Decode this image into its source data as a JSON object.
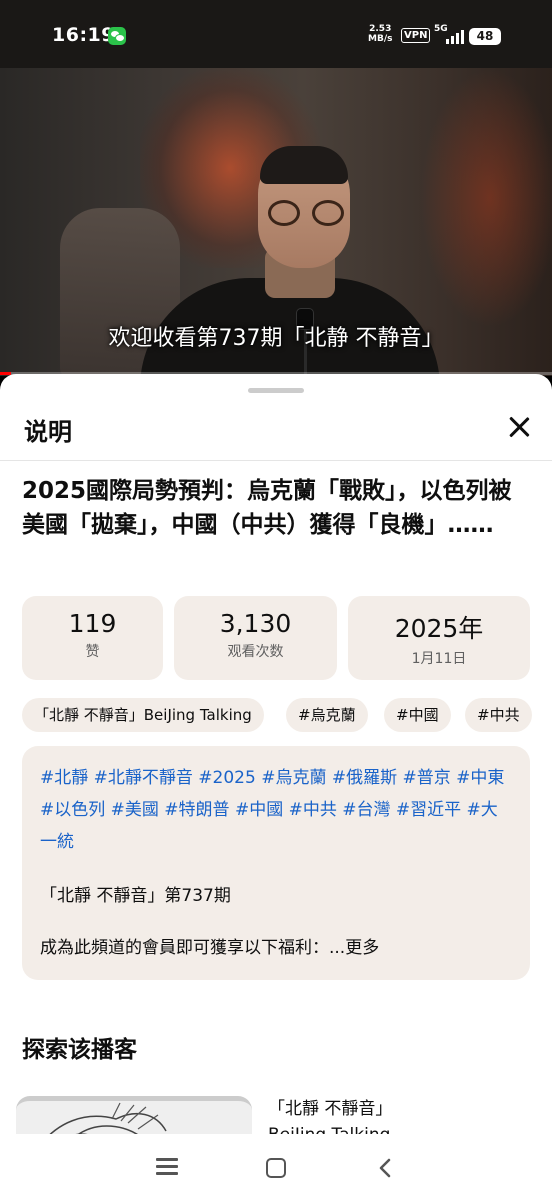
{
  "status_bar": {
    "time": "16:19",
    "speed_value": "2.53",
    "speed_unit": "MB/s",
    "vpn": "VPN",
    "network": "5G",
    "battery": "48"
  },
  "video": {
    "subtitle": "欢迎收看第737期「北静 不静音」",
    "progress": 0.02
  },
  "sheet": {
    "title": "说明",
    "video_title": "2025國際局勢預判：烏克蘭「戰敗」，以色列被美國「拋棄」，中國（中共）獲得「良機」……",
    "stats": [
      {
        "value": "119",
        "label": "赞"
      },
      {
        "value": "3,130",
        "label": "观看次数"
      },
      {
        "value": "2025年",
        "label": "1月11日"
      }
    ],
    "chips": [
      "「北靜 不靜音」BeiJing Talking",
      "#烏克蘭",
      "#中國",
      "#中共"
    ],
    "description": {
      "hashtags": "#北靜 #北靜不靜音 #2025 #烏克蘭 #俄羅斯 #普京 #中東 #以色列 #美國 #特朗普 #中國 #中共 #台灣 #習近平 #大一統",
      "episode": "「北靜 不靜音」第737期",
      "member_line": "成為此頻道的會員即可獲享以下福利：...更多"
    },
    "explore_title": "探索该播客",
    "podcast_line1": "「北靜 不靜音」",
    "podcast_line2": "BeiJing Talking"
  }
}
